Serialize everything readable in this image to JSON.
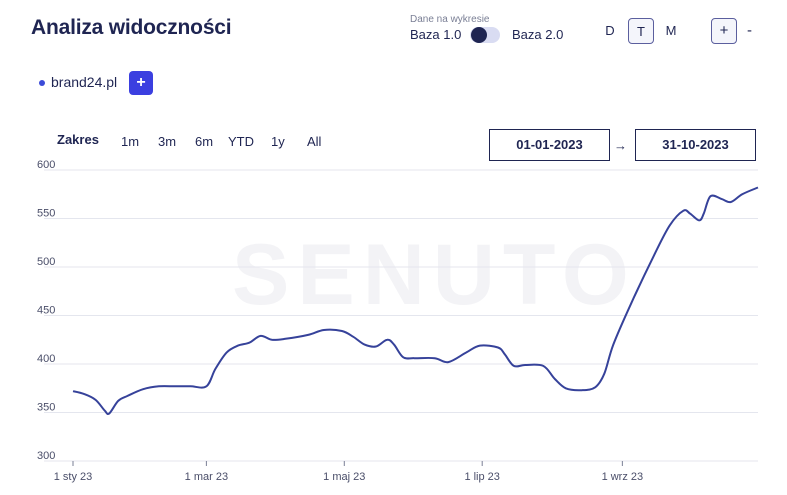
{
  "header": {
    "title": "Analiza widoczności",
    "baza_caption": "Dane na wykresie",
    "baza_left": "Baza 1.0",
    "baza_right": "Baza 2.0",
    "periods": [
      "D",
      "T",
      "M"
    ],
    "active_period": "T",
    "zoom_in": "+",
    "zoom_out": "-"
  },
  "legend": {
    "domain": "brand24.pl",
    "add_label": "+"
  },
  "range": {
    "label": "Zakres",
    "buttons": [
      "1m",
      "3m",
      "6m",
      "YTD",
      "1y",
      "All"
    ],
    "date_from": "01-01-2023",
    "arrow": "→",
    "date_to": "31-10-2023"
  },
  "watermark": "SENUTO",
  "colors": {
    "line": "#36429a",
    "accent": "#3b3fe0",
    "grid": "#e4e6ee"
  },
  "chart_data": {
    "type": "line",
    "ylim": [
      300,
      600
    ],
    "yticks": [
      300,
      350,
      400,
      450,
      500,
      550,
      600
    ],
    "x_range": [
      "2023-01-01",
      "2023-10-31"
    ],
    "xticks": [
      {
        "date": "2023-01-01",
        "label": "1 sty 23"
      },
      {
        "date": "2023-03-01",
        "label": "1 mar 23"
      },
      {
        "date": "2023-05-01",
        "label": "1 maj 23"
      },
      {
        "date": "2023-07-01",
        "label": "1 lip 23"
      },
      {
        "date": "2023-09-01",
        "label": "1 wrz 23"
      }
    ],
    "grid": true,
    "series": [
      {
        "points": [
          [
            "2023-01-01",
            372
          ],
          [
            "2023-01-06",
            369
          ],
          [
            "2023-01-11",
            363
          ],
          [
            "2023-01-15",
            352
          ],
          [
            "2023-01-17",
            349
          ],
          [
            "2023-01-21",
            362
          ],
          [
            "2023-01-25",
            367
          ],
          [
            "2023-02-01",
            374
          ],
          [
            "2023-02-08",
            377
          ],
          [
            "2023-02-15",
            377
          ],
          [
            "2023-02-22",
            377
          ],
          [
            "2023-03-01",
            377
          ],
          [
            "2023-03-05",
            395
          ],
          [
            "2023-03-10",
            412
          ],
          [
            "2023-03-15",
            419
          ],
          [
            "2023-03-20",
            422
          ],
          [
            "2023-03-25",
            429
          ],
          [
            "2023-03-30",
            425
          ],
          [
            "2023-04-05",
            426
          ],
          [
            "2023-04-15",
            430
          ],
          [
            "2023-04-22",
            435
          ],
          [
            "2023-04-30",
            434
          ],
          [
            "2023-05-05",
            428
          ],
          [
            "2023-05-10",
            420
          ],
          [
            "2023-05-15",
            418
          ],
          [
            "2023-05-20",
            425
          ],
          [
            "2023-05-23",
            420
          ],
          [
            "2023-05-27",
            407
          ],
          [
            "2023-06-01",
            406
          ],
          [
            "2023-06-10",
            406
          ],
          [
            "2023-06-16",
            402
          ],
          [
            "2023-06-24",
            412
          ],
          [
            "2023-06-30",
            419
          ],
          [
            "2023-07-08",
            417
          ],
          [
            "2023-07-11",
            410
          ],
          [
            "2023-07-15",
            398
          ],
          [
            "2023-07-20",
            399
          ],
          [
            "2023-07-28",
            398
          ],
          [
            "2023-08-02",
            385
          ],
          [
            "2023-08-07",
            375
          ],
          [
            "2023-08-14",
            373
          ],
          [
            "2023-08-20",
            376
          ],
          [
            "2023-08-24",
            390
          ],
          [
            "2023-08-28",
            420
          ],
          [
            "2023-09-05",
            463
          ],
          [
            "2023-09-15",
            512
          ],
          [
            "2023-09-22",
            543
          ],
          [
            "2023-09-28",
            558
          ],
          [
            "2023-10-01",
            555
          ],
          [
            "2023-10-05",
            548
          ],
          [
            "2023-10-07",
            555
          ],
          [
            "2023-10-10",
            573
          ],
          [
            "2023-10-15",
            570
          ],
          [
            "2023-10-19",
            567
          ],
          [
            "2023-10-24",
            575
          ],
          [
            "2023-10-31",
            582
          ]
        ]
      }
    ]
  }
}
